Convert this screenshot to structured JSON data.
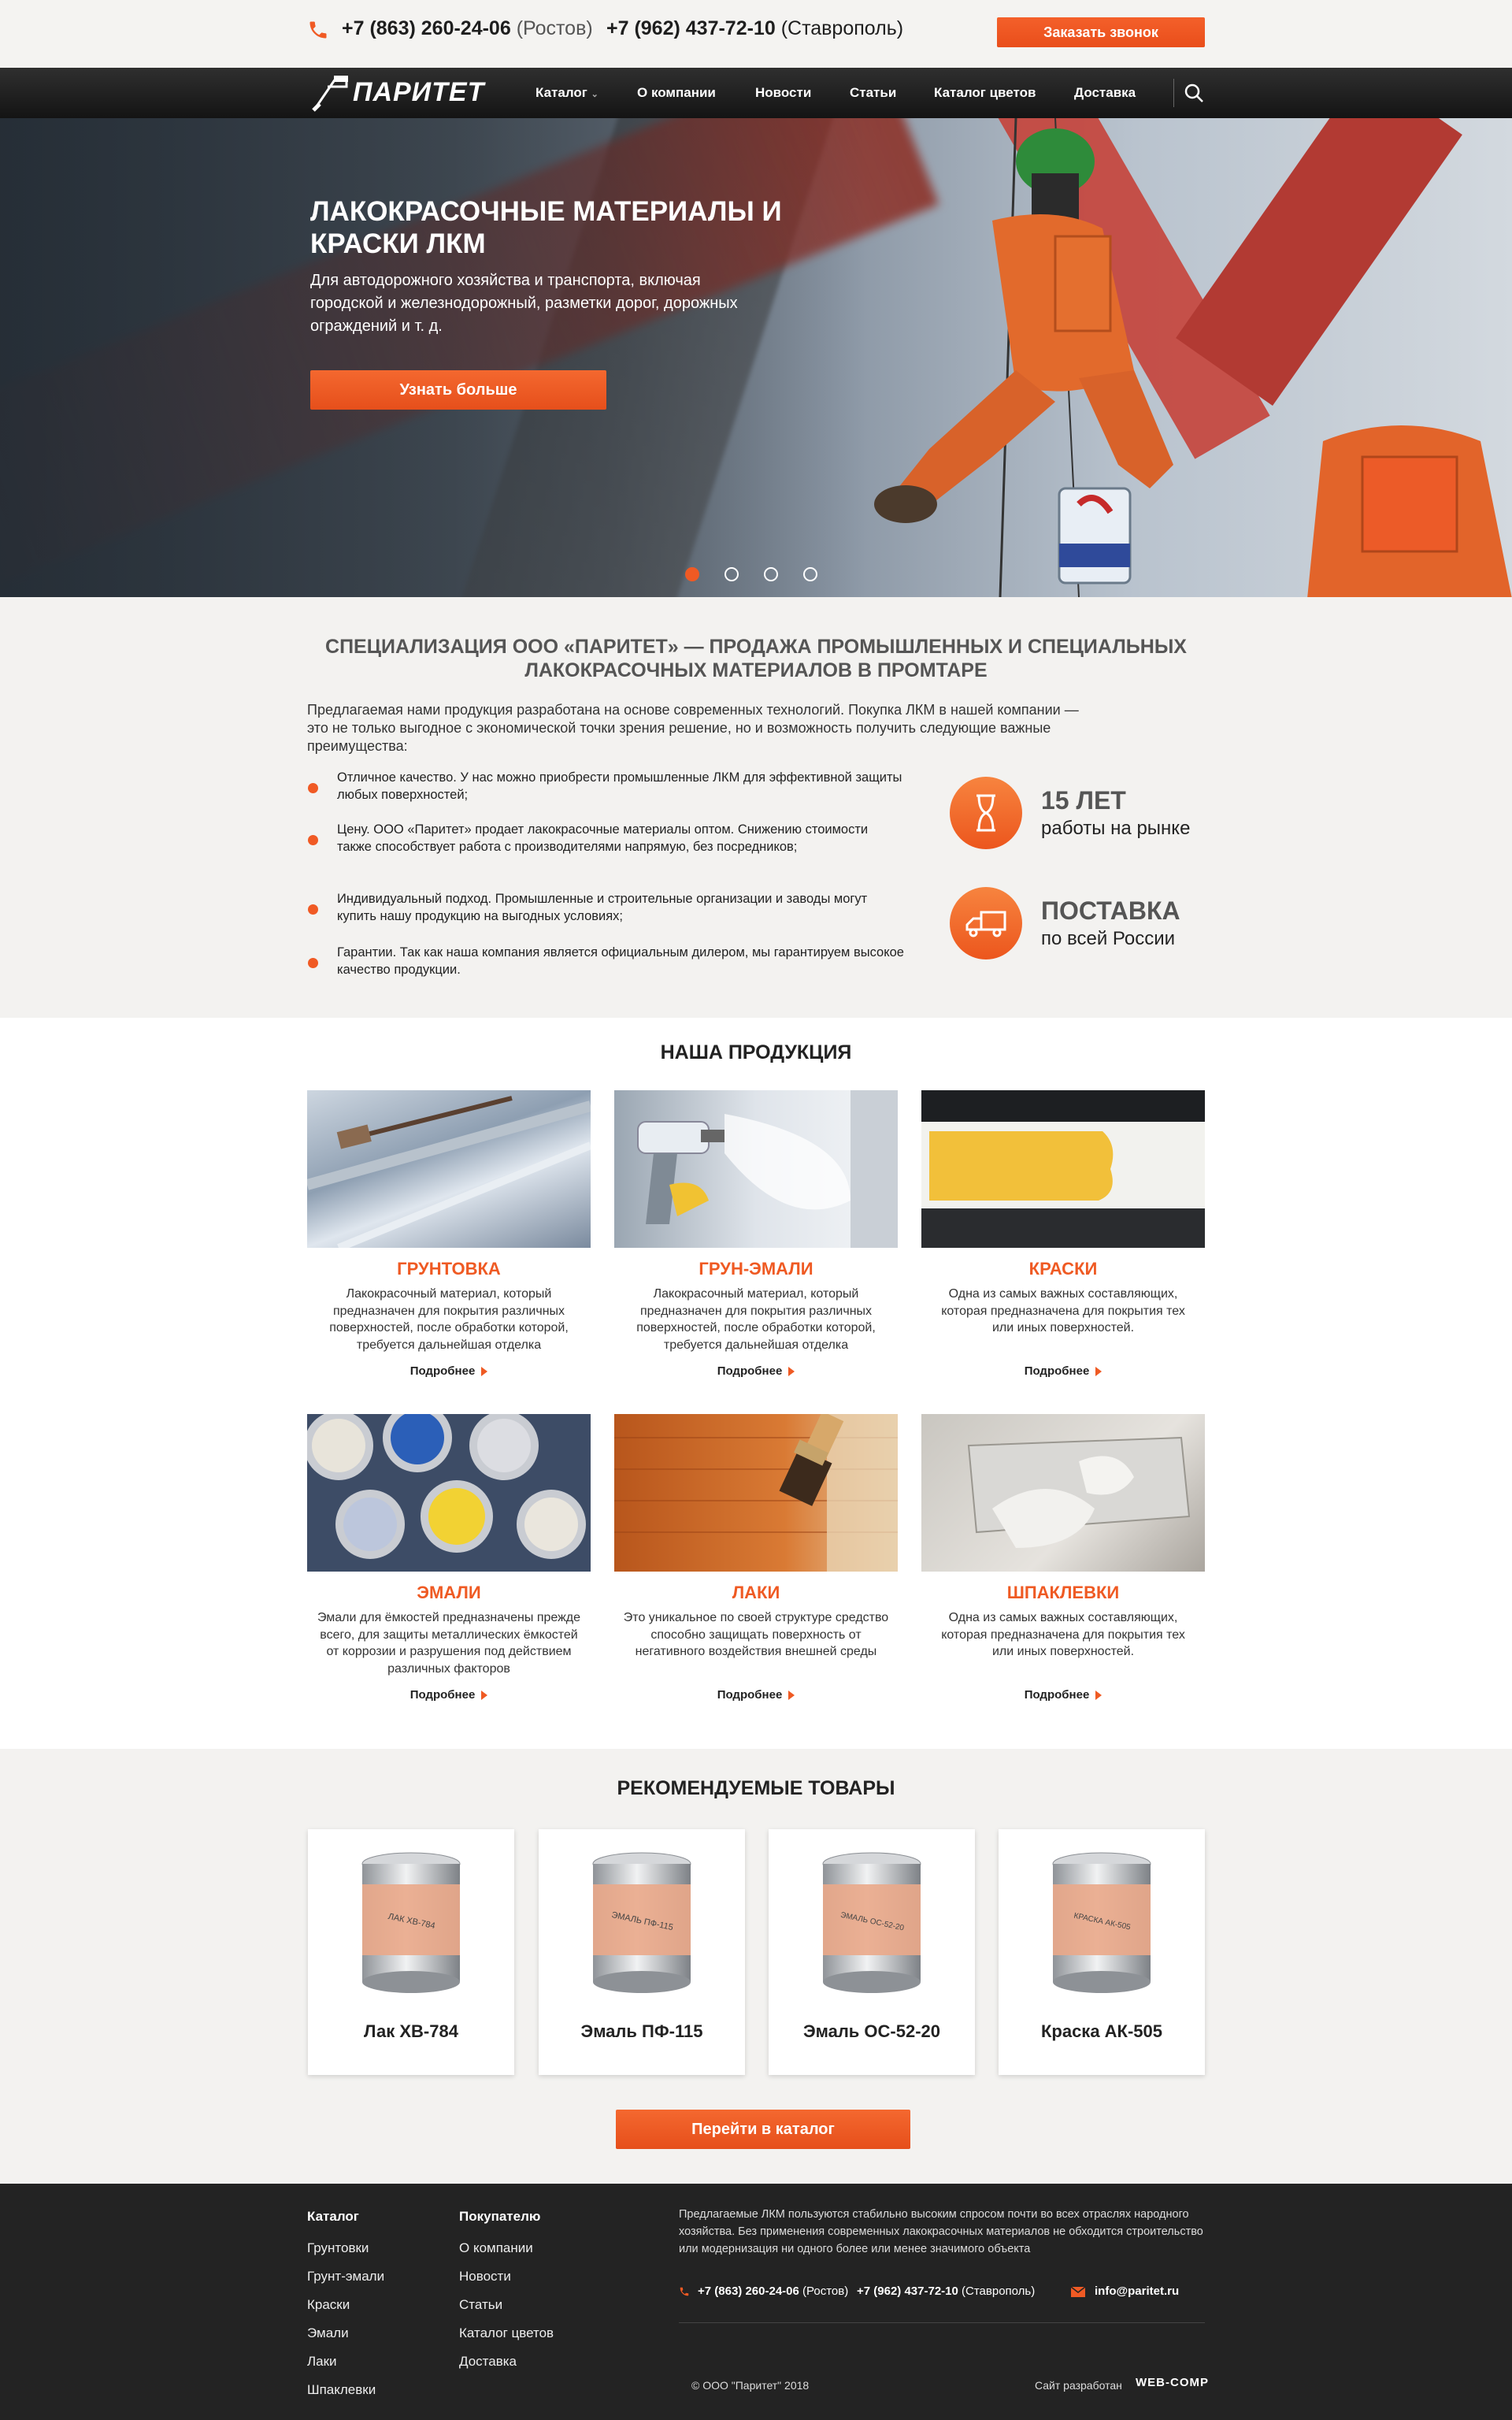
{
  "colors": {
    "accent": "#f05a24",
    "dark": "#232323",
    "nav": "#1c1c1c"
  },
  "topbar": {
    "phone_icon": "phone-icon",
    "phone1_number": "+7 (863) 260-24-06",
    "phone1_city": "(Ростов)",
    "phone2_number": "+7 (962) 437-72-10",
    "phone2_city": "(Ставрополь)",
    "callback_label": "Заказать звонок"
  },
  "nav": {
    "logo_text": "ПАРИТЕТ",
    "items": [
      {
        "label": "Каталог"
      },
      {
        "label": "О компании"
      },
      {
        "label": "Новости"
      },
      {
        "label": "Статьи"
      },
      {
        "label": "Каталог цветов"
      },
      {
        "label": "Доставка"
      }
    ],
    "search_icon": "search-icon"
  },
  "hero": {
    "title": "Лакокрасочные материалы и краски ЛКМ",
    "text": "Для автодорожного хозяйства и транспорта, включая городской и железнодорожный, разметки дорог, дорожных ограждений и т. д.",
    "button": "Узнать больше",
    "slides_count": 4,
    "active_slide": 1
  },
  "spec": {
    "title": "Специализация ООО «Паритет» — продажа промышленных и специальных лакокрасочных материалов в промтаре",
    "intro": "Предлагаемая нами продукция разработана на основе современных технологий. Покупка ЛКМ в нашей компании — это не только выгодное с экономической точки зрения решение, но и возможность получить следующие важные преимущества:",
    "bullets": [
      "Отличное качество. У нас можно приобрести промышленные ЛКМ для эффективной защиты любых поверхностей;",
      "Цену. ООО «Паритет» продает лакокрасочные материалы оптом. Снижению стоимости также способствует работа с производителями напрямую, без посредников;",
      "Индивидуальный подход. Промышленные и строительные организации и заводы могут купить нашу продукцию на выгодных условиях;",
      "Гарантии. Так как наша компания является официальным дилером, мы гарантируем высокое качество   продукции."
    ],
    "features": [
      {
        "big": "15 ЛЕТ",
        "small": "работы на рынке",
        "icon": "hourglass-icon"
      },
      {
        "big": "ПОСТАВКА",
        "small": "по всей России",
        "icon": "truck-icon"
      }
    ]
  },
  "products": {
    "title": "Наша продукция",
    "more_label": "Подробнее",
    "items": [
      {
        "name": "Грунтовка",
        "desc": "Лакокрасочный материал, который предназначен для покрытия различных поверхностей, после обработки которой, требуется дальнейшая отделка"
      },
      {
        "name": "Грун-эмали",
        "desc": "Лакокрасочный материал, который предназначен для покрытия различных поверхностей, после обработки которой, требуется дальнейшая отделка"
      },
      {
        "name": "Краски",
        "desc": "Одна из самых важных составляющих, которая предназначена для покрытия тех или иных поверхностей."
      },
      {
        "name": "Эмали",
        "desc": "Эмали для ёмкостей предназначены прежде всего, для защиты металлических ёмкостей от коррозии и разрушения под действием различных факторов"
      },
      {
        "name": "Лаки",
        "desc": "Это уникальное по своей структуре средство способно защищать поверхность от негативного воздействия внешней среды"
      },
      {
        "name": "Шпаклевки",
        "desc": "Одна из самых важных составляющих, которая предназначена для покрытия тех или иных поверхностей."
      }
    ]
  },
  "recommended": {
    "title": "Рекомендуемые товары",
    "items": [
      {
        "name": "Лак ХВ-784",
        "can_label": "ЛАК ХВ-784"
      },
      {
        "name": "Эмаль ПФ-115",
        "can_label": "ЭМАЛЬ ПФ-115"
      },
      {
        "name": "Эмаль ОС-52-20",
        "can_label": "ЭМАЛЬ ОС-52-20"
      },
      {
        "name": "Краска АК-505",
        "can_label": "КРАСКА АК-505"
      }
    ],
    "catalog_button": "Перейти в каталог"
  },
  "footer": {
    "catalog_title": "Каталог",
    "catalog_links": [
      "Грунтовки",
      "Грунт-эмали",
      "Краски",
      "Эмали",
      "Лаки",
      "Шпаклевки"
    ],
    "buyer_title": "Покупателю",
    "buyer_links": [
      "О компании",
      "Новости",
      "Статьи",
      "Каталог цветов",
      "Доставка"
    ],
    "text": "Предлагаемые ЛКМ пользуются стабильно высоким спросом почти во всех отраслях народного хозяйства. Без применения современных лакокрасочных материалов не обходится строительство или модернизация ни одного более или менее значимого объекта",
    "phone1_number": "+7 (863) 260-24-06",
    "phone1_city": "(Ростов)",
    "phone2_number": "+7 (962) 437-72-10",
    "phone2_city": "(Ставрополь)",
    "email": "info@paritet.ru",
    "copyright": "© ООО \"Паритет\" 2018",
    "developer_label": "Сайт разработан",
    "developer_name": "WEB-COMP"
  }
}
